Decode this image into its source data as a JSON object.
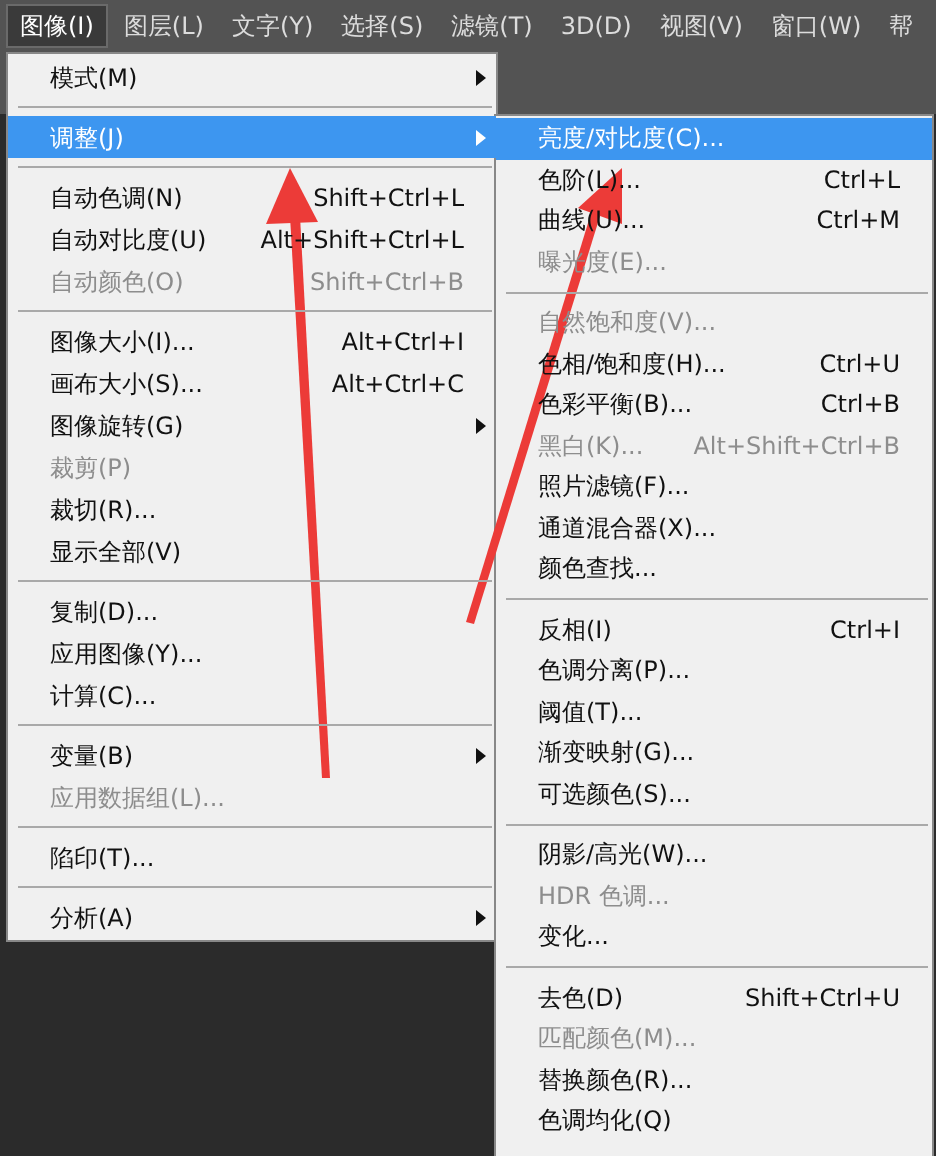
{
  "menubar": [
    {
      "label": "图像(I)",
      "selected": true
    },
    {
      "label": "图层(L)",
      "selected": false
    },
    {
      "label": "文字(Y)",
      "selected": false
    },
    {
      "label": "选择(S)",
      "selected": false
    },
    {
      "label": "滤镜(T)",
      "selected": false
    },
    {
      "label": "3D(D)",
      "selected": false
    },
    {
      "label": "视图(V)",
      "selected": false
    },
    {
      "label": "窗口(W)",
      "selected": false
    },
    {
      "label": "帮",
      "selected": false
    }
  ],
  "menu": {
    "items": [
      {
        "kind": "item",
        "label": "模式(M)",
        "selected": false,
        "disabled": false,
        "has_submenu": true
      },
      {
        "kind": "separator"
      },
      {
        "kind": "item",
        "label": "调整(J)",
        "selected": true,
        "disabled": false,
        "has_submenu": true
      },
      {
        "kind": "separator"
      },
      {
        "kind": "item",
        "label": "自动色调(N)",
        "shortcut": "Shift+Ctrl+L",
        "selected": false,
        "disabled": false,
        "has_submenu": false
      },
      {
        "kind": "item",
        "label": "自动对比度(U)",
        "shortcut": "Alt+Shift+Ctrl+L",
        "selected": false,
        "disabled": false,
        "has_submenu": false
      },
      {
        "kind": "item",
        "label": "自动颜色(O)",
        "shortcut": "Shift+Ctrl+B",
        "selected": false,
        "disabled": true,
        "has_submenu": false
      },
      {
        "kind": "separator"
      },
      {
        "kind": "item",
        "label": "图像大小(I)...",
        "shortcut": "Alt+Ctrl+I",
        "selected": false,
        "disabled": false,
        "has_submenu": false
      },
      {
        "kind": "item",
        "label": "画布大小(S)...",
        "shortcut": "Alt+Ctrl+C",
        "selected": false,
        "disabled": false,
        "has_submenu": false
      },
      {
        "kind": "item",
        "label": "图像旋转(G)",
        "selected": false,
        "disabled": false,
        "has_submenu": true
      },
      {
        "kind": "item",
        "label": "裁剪(P)",
        "selected": false,
        "disabled": true,
        "has_submenu": false
      },
      {
        "kind": "item",
        "label": "裁切(R)...",
        "selected": false,
        "disabled": false,
        "has_submenu": false
      },
      {
        "kind": "item",
        "label": "显示全部(V)",
        "selected": false,
        "disabled": false,
        "has_submenu": false
      },
      {
        "kind": "separator"
      },
      {
        "kind": "item",
        "label": "复制(D)...",
        "selected": false,
        "disabled": false,
        "has_submenu": false
      },
      {
        "kind": "item",
        "label": "应用图像(Y)...",
        "selected": false,
        "disabled": false,
        "has_submenu": false
      },
      {
        "kind": "item",
        "label": "计算(C)...",
        "selected": false,
        "disabled": false,
        "has_submenu": false
      },
      {
        "kind": "separator"
      },
      {
        "kind": "item",
        "label": "变量(B)",
        "selected": false,
        "disabled": false,
        "has_submenu": true
      },
      {
        "kind": "item",
        "label": "应用数据组(L)...",
        "selected": false,
        "disabled": true,
        "has_submenu": false
      },
      {
        "kind": "separator"
      },
      {
        "kind": "item",
        "label": "陷印(T)...",
        "selected": false,
        "disabled": false,
        "has_submenu": false
      },
      {
        "kind": "separator"
      },
      {
        "kind": "item",
        "label": "分析(A)",
        "selected": false,
        "disabled": false,
        "has_submenu": true
      }
    ]
  },
  "submenu": {
    "items": [
      {
        "kind": "item",
        "label": "亮度/对比度(C)...",
        "selected": true,
        "disabled": false
      },
      {
        "kind": "item",
        "label": "色阶(L)...",
        "shortcut": "Ctrl+L",
        "selected": false,
        "disabled": false
      },
      {
        "kind": "item",
        "label": "曲线(U)...",
        "shortcut": "Ctrl+M",
        "selected": false,
        "disabled": false
      },
      {
        "kind": "item",
        "label": "曝光度(E)...",
        "selected": false,
        "disabled": true
      },
      {
        "kind": "separator"
      },
      {
        "kind": "item",
        "label": "自然饱和度(V)...",
        "selected": false,
        "disabled": true
      },
      {
        "kind": "item",
        "label": "色相/饱和度(H)...",
        "shortcut": "Ctrl+U",
        "selected": false,
        "disabled": false
      },
      {
        "kind": "item",
        "label": "色彩平衡(B)...",
        "shortcut": "Ctrl+B",
        "selected": false,
        "disabled": false
      },
      {
        "kind": "item",
        "label": "黑白(K)...",
        "shortcut": "Alt+Shift+Ctrl+B",
        "selected": false,
        "disabled": true
      },
      {
        "kind": "item",
        "label": "照片滤镜(F)...",
        "selected": false,
        "disabled": false
      },
      {
        "kind": "item",
        "label": "通道混合器(X)...",
        "selected": false,
        "disabled": false
      },
      {
        "kind": "item",
        "label": "颜色查找...",
        "selected": false,
        "disabled": false
      },
      {
        "kind": "separator"
      },
      {
        "kind": "item",
        "label": "反相(I)",
        "shortcut": "Ctrl+I",
        "selected": false,
        "disabled": false
      },
      {
        "kind": "item",
        "label": "色调分离(P)...",
        "selected": false,
        "disabled": false
      },
      {
        "kind": "item",
        "label": "阈值(T)...",
        "selected": false,
        "disabled": false
      },
      {
        "kind": "item",
        "label": "渐变映射(G)...",
        "selected": false,
        "disabled": false
      },
      {
        "kind": "item",
        "label": "可选颜色(S)...",
        "selected": false,
        "disabled": false
      },
      {
        "kind": "separator"
      },
      {
        "kind": "item",
        "label": "阴影/高光(W)...",
        "selected": false,
        "disabled": false
      },
      {
        "kind": "item",
        "label": "HDR 色调...",
        "selected": false,
        "disabled": true
      },
      {
        "kind": "item",
        "label": "变化...",
        "selected": false,
        "disabled": false
      },
      {
        "kind": "separator"
      },
      {
        "kind": "item",
        "label": "去色(D)",
        "shortcut": "Shift+Ctrl+U",
        "selected": false,
        "disabled": false
      },
      {
        "kind": "item",
        "label": "匹配颜色(M)...",
        "selected": false,
        "disabled": true
      },
      {
        "kind": "item",
        "label": "替换颜色(R)...",
        "selected": false,
        "disabled": false
      },
      {
        "kind": "item",
        "label": "色调均化(Q)",
        "selected": false,
        "disabled": false
      }
    ]
  }
}
